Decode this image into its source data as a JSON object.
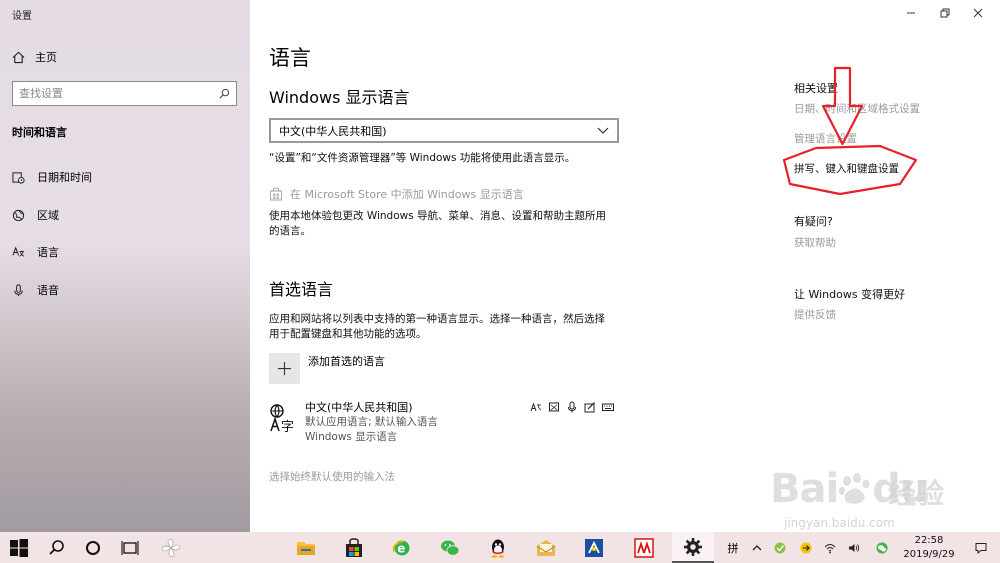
{
  "window": {
    "title": "设置"
  },
  "sidebar": {
    "home_label": "主页",
    "search_placeholder": "查找设置",
    "section_title": "时间和语言",
    "items": [
      {
        "label": "日期和时间",
        "icon": "clock-calendar-icon"
      },
      {
        "label": "区域",
        "icon": "globe-region-icon"
      },
      {
        "label": "语言",
        "icon": "language-icon"
      },
      {
        "label": "语音",
        "icon": "microphone-icon"
      }
    ]
  },
  "main": {
    "page_title": "语言",
    "display_language": {
      "heading": "Windows 显示语言",
      "selected": "中文(中华人民共和国)",
      "description": "“设置”和“文件资源管理器”等 Windows 功能将使用此语言显示。",
      "store_link": "在 Microsoft Store 中添加 Windows 显示语言",
      "store_desc_line1": "使用本地体验包更改 Windows 导航、菜单、消息、设置和帮助主题所用",
      "store_desc_line2": "的语言。"
    },
    "preferred": {
      "heading": "首选语言",
      "desc_line1": "应用和网站将以列表中支持的第一种语言显示。选择一种语言，然后选择",
      "desc_line2": "用于配置键盘和其他功能的选项。",
      "add_label": "添加首选的语言",
      "language": {
        "name": "中文(中华人民共和国)",
        "sub1": "默认应用语言; 默认输入语言",
        "sub2": "Windows 显示语言"
      },
      "input_method_link": "选择始终默认使用的输入法"
    }
  },
  "right": {
    "related_heading": "相关设置",
    "related_links": [
      "日期、时间和区域格式设置",
      "管理语言设置",
      "拼写、键入和键盘设置"
    ],
    "question_heading": "有疑问?",
    "help_link": "获取帮助",
    "improve_heading": "让 Windows 变得更好",
    "feedback_link": "提供反馈"
  },
  "annotation": {
    "color": "#e8202a"
  },
  "watermark": {
    "brand": "Bai",
    "brand2": "du",
    "cn": "经验",
    "url": "jingyan.baidu.com"
  },
  "taskbar": {
    "ime": "拼",
    "time": "22:58",
    "date": "2019/9/29"
  },
  "colors": {
    "dim_text": "#9a9a9a",
    "taskbar_bg": "#f2e3e5",
    "accent": "#0078d7"
  }
}
